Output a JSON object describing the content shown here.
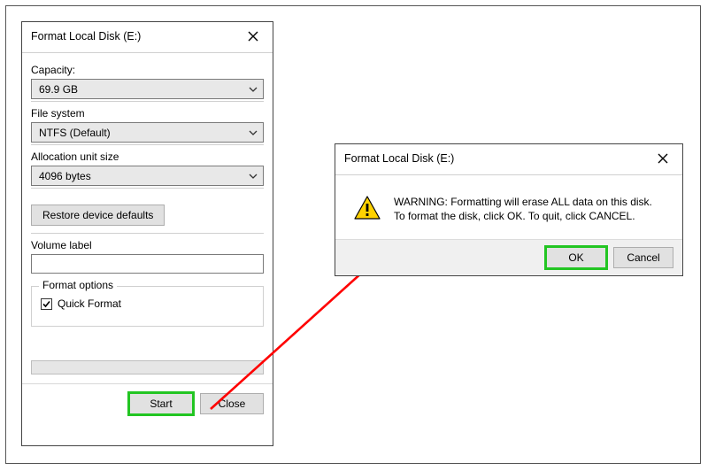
{
  "format_dialog": {
    "title": "Format Local Disk (E:)",
    "capacity_label": "Capacity:",
    "capacity_value": "69.9 GB",
    "filesystem_label": "File system",
    "filesystem_value": "NTFS (Default)",
    "allocation_label": "Allocation unit size",
    "allocation_value": "4096 bytes",
    "restore_defaults": "Restore device defaults",
    "volume_label_label": "Volume label",
    "volume_label_value": "",
    "format_options_title": "Format options",
    "quick_format_label": "Quick Format",
    "quick_format_checked": true,
    "start_label": "Start",
    "close_label": "Close"
  },
  "confirm_dialog": {
    "title": "Format Local Disk (E:)",
    "message_line1": "WARNING: Formatting will erase ALL data on this disk.",
    "message_line2": "To format the disk, click OK. To quit, click CANCEL.",
    "ok_label": "OK",
    "cancel_label": "Cancel"
  }
}
